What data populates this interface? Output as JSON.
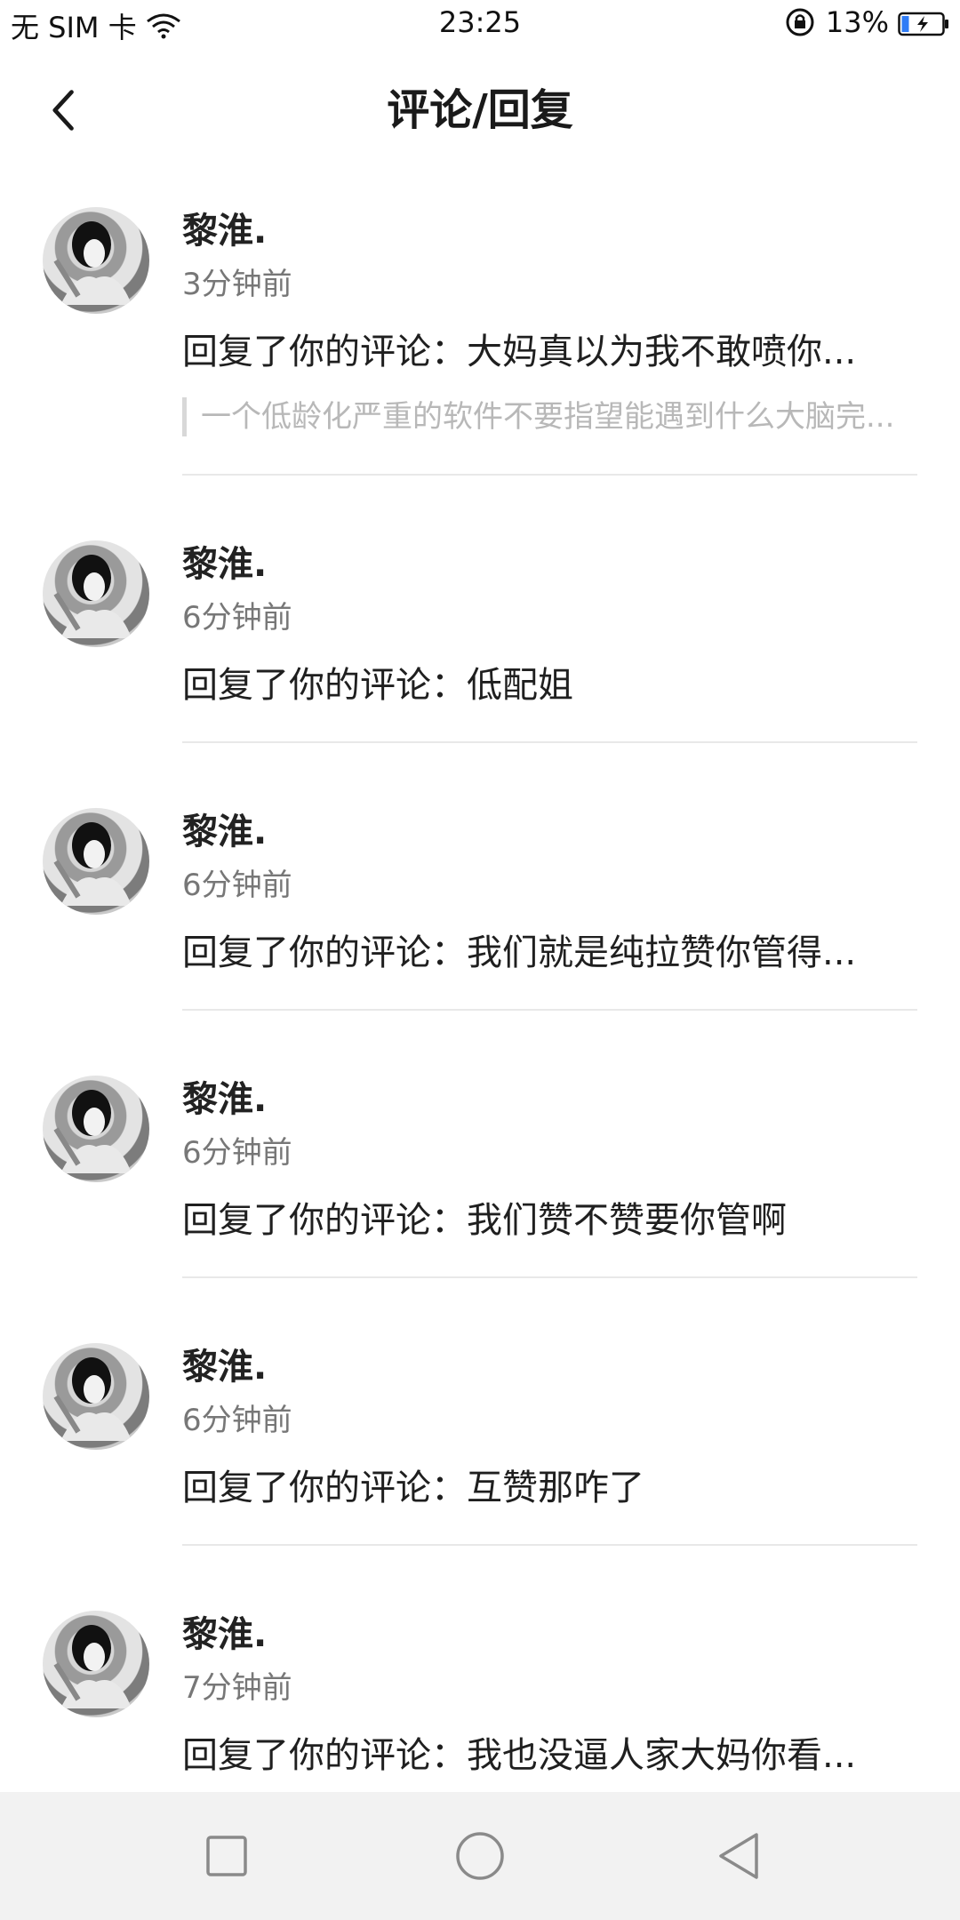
{
  "status_bar": {
    "carrier": "无 SIM 卡",
    "time": "23:25",
    "battery": "13%"
  },
  "header": {
    "title": "评论/回复",
    "back_icon": "chevron-left-icon"
  },
  "items": [
    {
      "username": "黎淮.",
      "time": "3分钟前",
      "reply": "回复了你的评论：大妈真以为我不敢喷你...",
      "quote": "一个低龄化严重的软件不要指望能遇到什么大脑完..."
    },
    {
      "username": "黎淮.",
      "time": "6分钟前",
      "reply": "回复了你的评论：低配姐"
    },
    {
      "username": "黎淮.",
      "time": "6分钟前",
      "reply": "回复了你的评论：我们就是纯拉赞你管得..."
    },
    {
      "username": "黎淮.",
      "time": "6分钟前",
      "reply": "回复了你的评论：我们赞不赞要你管啊"
    },
    {
      "username": "黎淮.",
      "time": "6分钟前",
      "reply": "回复了你的评论：互赞那咋了"
    },
    {
      "username": "黎淮.",
      "time": "7分钟前",
      "reply": "回复了你的评论：我也没逼人家大妈你看..."
    }
  ],
  "navbar": {
    "recent_icon": "square-icon",
    "home_icon": "circle-icon",
    "back_icon": "triangle-back-icon"
  },
  "colors": {
    "text_primary": "#1f1f1f",
    "text_secondary": "#777777",
    "quote_text": "#b8b8b8",
    "divider": "#e8e8e8",
    "navbar_bg": "#f2f2f2"
  }
}
